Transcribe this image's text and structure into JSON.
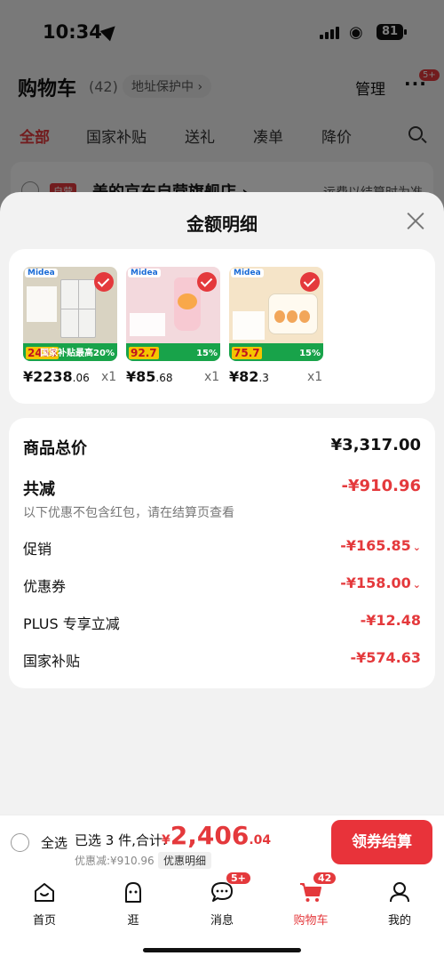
{
  "status_bar": {
    "time": "10:34",
    "battery": "81"
  },
  "cart_header": {
    "title": "购物车",
    "count": "(42)",
    "address_protect": "地址保护中 ›",
    "manage": "管理",
    "more_badge": "5+"
  },
  "filter_tabs": [
    "全部",
    "国家补贴",
    "送礼",
    "凑单",
    "降价"
  ],
  "store_row": {
    "tag": "自营",
    "name": "美的京东自营旗舰店 ›",
    "shipping": "运费以结算时为准"
  },
  "sheet": {
    "title": "金额明细",
    "items": [
      {
        "brand": "Midea",
        "promo_price": "2455",
        "promo_tag": "国家补贴最高20%",
        "price_int": "¥2238",
        "price_dec": ".06",
        "qty": "x1",
        "thumb_bg": "#d9d3c2"
      },
      {
        "brand": "Midea",
        "promo_price": "92.7",
        "promo_tag": "15%",
        "price_int": "¥85",
        "price_dec": ".68",
        "qty": "x1",
        "thumb_bg": "#f3d9dd"
      },
      {
        "brand": "Midea",
        "promo_price": "75.7",
        "promo_tag": "15%",
        "price_int": "¥82",
        "price_dec": ".3",
        "qty": "x1",
        "thumb_bg": "#f5e4c8"
      }
    ],
    "details": {
      "goods_total_label": "商品总价",
      "goods_total_value": "¥3,317.00",
      "total_discount_label": "共减",
      "total_discount_value": "-¥910.96",
      "discount_note": "以下优惠不包含红包，请在结算页查看",
      "promotion_label": "促销",
      "promotion_value": "-¥165.85",
      "coupon_label": "优惠券",
      "coupon_value": "-¥158.00",
      "plus_label": "PLUS 专享立减",
      "plus_value": "-¥12.48",
      "subsidy_label": "国家补贴",
      "subsidy_value": "-¥574.63"
    }
  },
  "checkout": {
    "select_all": "全选",
    "summary": "已选 3 件,合计:",
    "total_currency": "¥",
    "total_int": "2,406",
    "total_dec": ".04",
    "discount_text": "优惠减:¥910.96",
    "detail_chip": "优惠明细",
    "button": "领券结算"
  },
  "tabbar": {
    "tabs": [
      {
        "label": "首页",
        "icon": "home-icon"
      },
      {
        "label": "逛",
        "icon": "browse-face-icon"
      },
      {
        "label": "消息",
        "icon": "message-icon",
        "badge": "5+"
      },
      {
        "label": "购物车",
        "icon": "cart-icon",
        "badge": "42"
      },
      {
        "label": "我的",
        "icon": "profile-icon"
      }
    ]
  },
  "colors": {
    "accent": "#e4393c",
    "promo_green": "#18a34a"
  }
}
